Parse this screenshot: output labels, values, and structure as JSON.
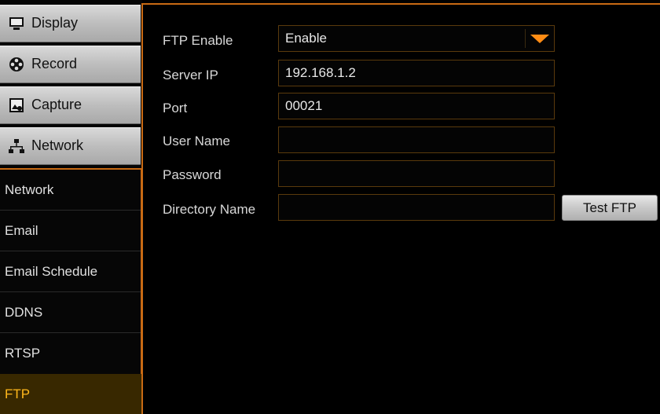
{
  "sidebar": {
    "menu": [
      {
        "label": "Display",
        "icon": "monitor-icon"
      },
      {
        "label": "Record",
        "icon": "film-reel-icon"
      },
      {
        "label": "Capture",
        "icon": "camera-capture-icon"
      },
      {
        "label": "Network",
        "icon": "network-icon"
      }
    ],
    "submenu": [
      {
        "label": "Network"
      },
      {
        "label": "Email"
      },
      {
        "label": "Email Schedule"
      },
      {
        "label": "DDNS"
      },
      {
        "label": "RTSP"
      }
    ],
    "active_item": {
      "label": "FTP"
    }
  },
  "form": {
    "ftp_enable": {
      "label": "FTP Enable",
      "value": "Enable"
    },
    "server_ip": {
      "label": "Server IP",
      "value": "192.168.1.2"
    },
    "port": {
      "label": "Port",
      "value": "00021"
    },
    "user_name": {
      "label": "User Name",
      "value": ""
    },
    "password": {
      "label": "Password",
      "value": ""
    },
    "directory_name": {
      "label": "Directory Name",
      "value": ""
    },
    "test_button": "Test FTP"
  },
  "colors": {
    "accent": "#c86a14",
    "active_text": "#ffb81c",
    "dropdown_arrow": "#ff8c14"
  }
}
